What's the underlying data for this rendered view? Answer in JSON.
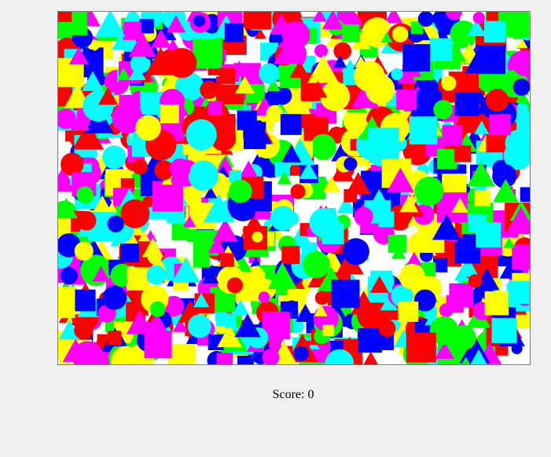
{
  "game": {
    "board": {
      "palette": [
        "#ff0000",
        "#00ff00",
        "#0000ff",
        "#ffff00",
        "#ff00ff",
        "#00ffff"
      ],
      "shape_kinds": [
        "circle",
        "square",
        "triangle"
      ]
    },
    "score_label": "Score:",
    "score_value": "0"
  }
}
